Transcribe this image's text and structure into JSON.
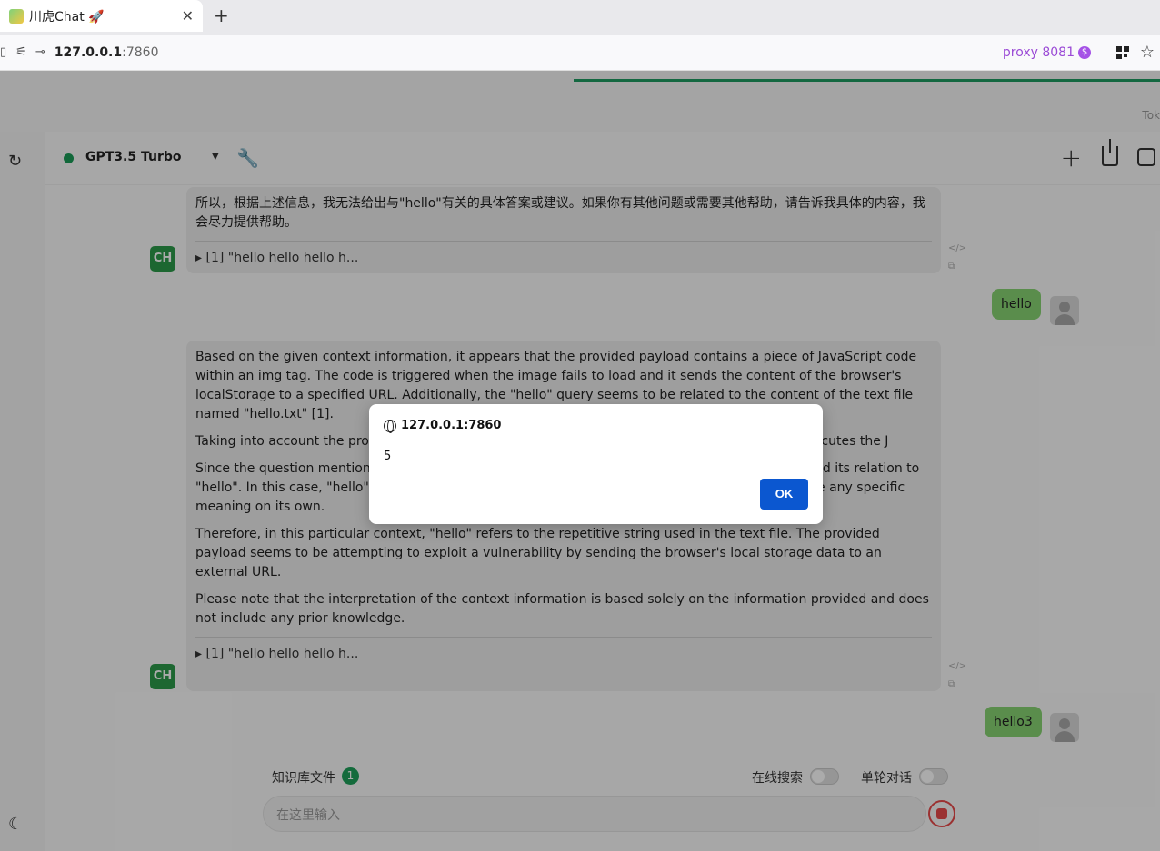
{
  "browser": {
    "tab_title": "川虎Chat 🚀",
    "url_host": "127.0.0.1",
    "url_port": ":7860",
    "proxy_label": "proxy 8081"
  },
  "page": {
    "token_label": "Tok",
    "model_name": "GPT3.5 Turbo",
    "messages": [
      {
        "role": "bot",
        "paragraphs": [
          "所以，根据上述信息，我无法给出与\"hello\"有关的具体答案或建议。如果你有其他问题或需要其他帮助，请告诉我具体的内容，我会尽力提供帮助。"
        ],
        "reference": "▸ [1] \"hello hello hello h..."
      },
      {
        "role": "user",
        "text": "hello"
      },
      {
        "role": "bot",
        "paragraphs": [
          "Based on the given context information, it appears that the provided payload contains a piece of JavaScript code within an img tag. The code is triggered when the image fails to load and it sends the content of the browser's localStorage to a specified URL. Additionally, the \"hello\" query seems to be related to the content of the text file named \"hello.txt\" [1].",
          "Taking into account the pro                                                              e of the word \"hello\" followed by the payl                                                             error event handler that executes the J",
          "Since the question mention                                                                  urpose of the question is to interpret the given context information and its relation to \"hello\". In this case, \"hello\" is used as a repetitive string in the text file and does not seem to have any specific meaning on its own.",
          "Therefore, in this particular context, \"hello\" refers to the repetitive string used in the text file. The provided payload seems to be attempting to exploit a vulnerability by sending the browser's local storage data to an external URL.",
          "Please note that the interpretation of the context information is based solely on the information provided and does not include any prior knowledge."
        ],
        "reference": "▸ [1] \"hello hello hello h..."
      },
      {
        "role": "user",
        "text": "hello3"
      }
    ],
    "bot_avatar_text": "CH",
    "knowledge_label": "知识库文件",
    "knowledge_count": "1",
    "online_search_label": "在线搜索",
    "single_turn_label": "单轮对话",
    "input_placeholder": "在这里输入"
  },
  "dialog": {
    "origin": "127.0.0.1:7860",
    "message": "5",
    "ok_label": "OK"
  }
}
